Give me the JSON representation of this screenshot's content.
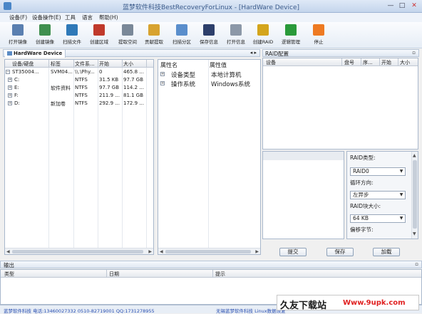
{
  "window": {
    "title": "蓝梦软件科技BestRecoveryForLinux - [HardWare Device]",
    "min": "—",
    "max": "□",
    "close": "✕"
  },
  "menu": [
    "设备(F)",
    "设备操作(E)",
    "工具",
    "语言",
    "帮助(H)"
  ],
  "toolbar": [
    {
      "label": "打开镜像",
      "icon": "open-image-icon",
      "color": "#5a7fb0"
    },
    {
      "label": "创建镜像",
      "icon": "create-image-icon",
      "color": "#3f8f4f"
    },
    {
      "label": "扫描文件",
      "icon": "scan-file-icon",
      "color": "#2f79b8"
    },
    {
      "label": "创建区域",
      "icon": "create-region-icon",
      "color": "#c0392b"
    },
    {
      "label": "提取空间",
      "icon": "extract-space-icon",
      "color": "#7a8898"
    },
    {
      "label": "贡献提取",
      "icon": "contribute-extract-icon",
      "color": "#d8a330"
    },
    {
      "label": "扫描分区",
      "icon": "scan-partition-icon",
      "color": "#5a8ecc"
    },
    {
      "label": "保存信息",
      "icon": "save-info-icon",
      "color": "#2d3f6b"
    },
    {
      "label": "打开信息",
      "icon": "open-info-icon",
      "color": "#8c98a8"
    },
    {
      "label": "创建RAID",
      "icon": "create-raid-icon",
      "color": "#d4a51c"
    },
    {
      "label": "逻辑管理",
      "icon": "logic-manage-icon",
      "color": "#2a9a3a"
    },
    {
      "label": "停止",
      "icon": "stop-icon",
      "color": "#ee7a22"
    }
  ],
  "left_panel": {
    "tab": "HardWare Device",
    "pin": "◂ ▸",
    "columns": [
      "设备/硬盘",
      "标签",
      "文件系...",
      "开始",
      "大小"
    ],
    "rows": [
      {
        "name": "ST35004...",
        "label": "SVM04...",
        "fs": "\\\\.\\Phy...",
        "start": "0",
        "size": "465.8 ...",
        "expander": "−"
      },
      {
        "name": "C:",
        "label": "",
        "fs": "NTFS",
        "start": "31.5 KB",
        "size": "97.7 GB",
        "expander": "+"
      },
      {
        "name": "E:",
        "label": "软件资料",
        "fs": "NTFS",
        "start": "97.7 GB",
        "size": "114.2 ...",
        "expander": "+"
      },
      {
        "name": "F:",
        "label": "",
        "fs": "NTFS",
        "start": "211.9 ...",
        "size": "81.1 GB",
        "expander": "+"
      },
      {
        "name": "D:",
        "label": "新加卷",
        "fs": "NTFS",
        "start": "292.9 ...",
        "size": "172.9 ...",
        "expander": "+"
      }
    ]
  },
  "props_panel": {
    "columns": [
      "属性名",
      "属性值"
    ],
    "rows": [
      {
        "name": "设备类型",
        "value": "本地计算机"
      },
      {
        "name": "操作系统",
        "value": "Windows系统"
      }
    ]
  },
  "raid_panel": {
    "title": "RAID配置",
    "pin": "▫",
    "columns": [
      "设备",
      "盘号",
      "序...",
      "开始",
      "大小"
    ],
    "type_label": "RAID类型:",
    "type_value": "RAID0",
    "direction_label": "循环方向:",
    "direction_value": "左异步",
    "block_label": "RAID块大小:",
    "block_value": "64 KB",
    "offset_label": "偏移字节:",
    "buttons": [
      "提交",
      "保存",
      "加载"
    ]
  },
  "output_panel": {
    "title": "输出",
    "pin": "▫",
    "columns": [
      "类型",
      "日期",
      "提示"
    ]
  },
  "statusbar": {
    "left": "蓝梦软件科技 电话:13460027332 0510-82719001 QQ:1731278955",
    "right": "无锡蓝梦软件科技 Linux数据恢复"
  },
  "watermark": {
    "text": "久友下载站",
    "url": "Www.9upk.com"
  }
}
